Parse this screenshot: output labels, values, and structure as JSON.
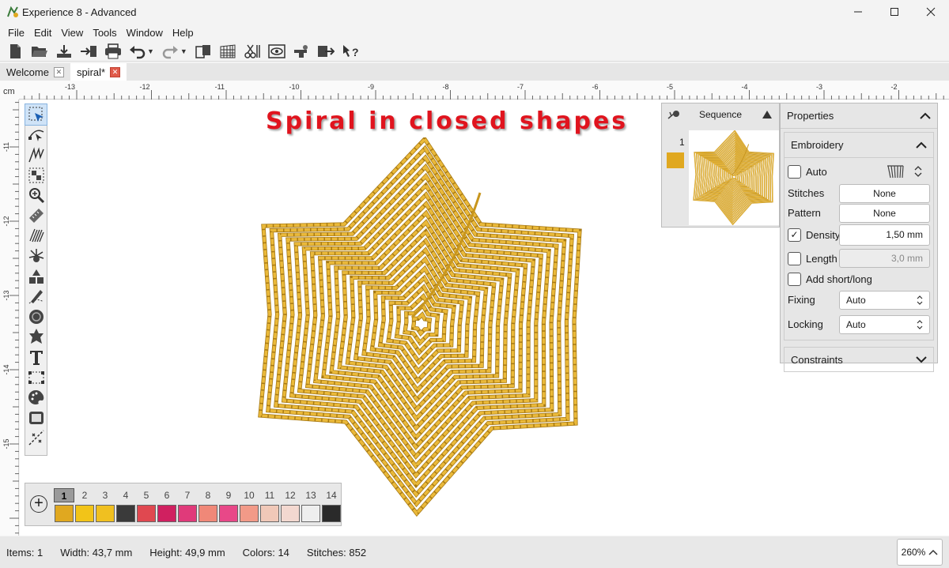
{
  "window": {
    "title": "Experience 8 - Advanced"
  },
  "menu": [
    "File",
    "Edit",
    "View",
    "Tools",
    "Window",
    "Help"
  ],
  "tabs": [
    {
      "label": "Welcome",
      "active": false
    },
    {
      "label": "spiral*",
      "active": true
    }
  ],
  "ruler": {
    "unit": "cm",
    "h_ticks": [
      "-13",
      "-12",
      "-11",
      "-10",
      "-9",
      "-8",
      "-7",
      "-6",
      "-5",
      "-4",
      "-3",
      "-2"
    ],
    "v_ticks": [
      "-11",
      "-12",
      "-13",
      "-14",
      "-15"
    ]
  },
  "canvas": {
    "design_title": "Spiral in closed shapes"
  },
  "palette": {
    "numbers": [
      "1",
      "2",
      "3",
      "4",
      "5",
      "6",
      "7",
      "8",
      "9",
      "10",
      "11",
      "12",
      "13",
      "14"
    ],
    "colors": [
      "#e0a820",
      "#f2c418",
      "#f0c020",
      "#3a3a3a",
      "#e04850",
      "#d02060",
      "#e03a7a",
      "#f08878",
      "#e84888",
      "#f29a88",
      "#f0c8b8",
      "#f3d8d0",
      "#eeeeee",
      "#2a2a2a"
    ],
    "selected": "1"
  },
  "sequence": {
    "title": "Sequence",
    "item_number": "1",
    "item_color": "#e0a820"
  },
  "properties": {
    "title": "Properties",
    "embroidery": {
      "title": "Embroidery",
      "auto_label": "Auto",
      "stitches_label": "Stitches",
      "stitches_value": "None",
      "pattern_label": "Pattern",
      "pattern_value": "None",
      "density_label": "Density",
      "density_value": "1,50 mm",
      "density_checked": true,
      "length_label": "Length",
      "length_value": "3,0 mm",
      "short_long_label": "Add short/long",
      "fixing_label": "Fixing",
      "fixing_value": "Auto",
      "locking_label": "Locking",
      "locking_value": "Auto"
    },
    "constraints_title": "Constraints"
  },
  "status": {
    "items": "Items: 1",
    "width": "Width: 43,7 mm",
    "height": "Height: 49,9 mm",
    "colors": "Colors: 14",
    "stitches": "Stitches: 852",
    "zoom": "260%"
  },
  "icons": {
    "toolbar": [
      "new-file-icon",
      "open-folder-icon",
      "save-icon",
      "export-icon",
      "print-icon",
      "undo-icon",
      "redo-icon",
      "paste-icon",
      "grid-icon",
      "cut-icon",
      "preview-icon",
      "machine-icon",
      "transfer-icon",
      "help-pointer-icon"
    ],
    "tools": [
      "select-icon",
      "node-edit-icon",
      "stitch-type-icon",
      "pattern-fill-icon",
      "zoom-icon",
      "measure-icon",
      "density-icon",
      "star-burst-icon",
      "shapes-icon",
      "pen-icon",
      "circle-icon",
      "star-icon",
      "text-icon",
      "bezier-icon",
      "paint-palette-icon",
      "hoop-icon",
      "reference-line-icon"
    ]
  }
}
